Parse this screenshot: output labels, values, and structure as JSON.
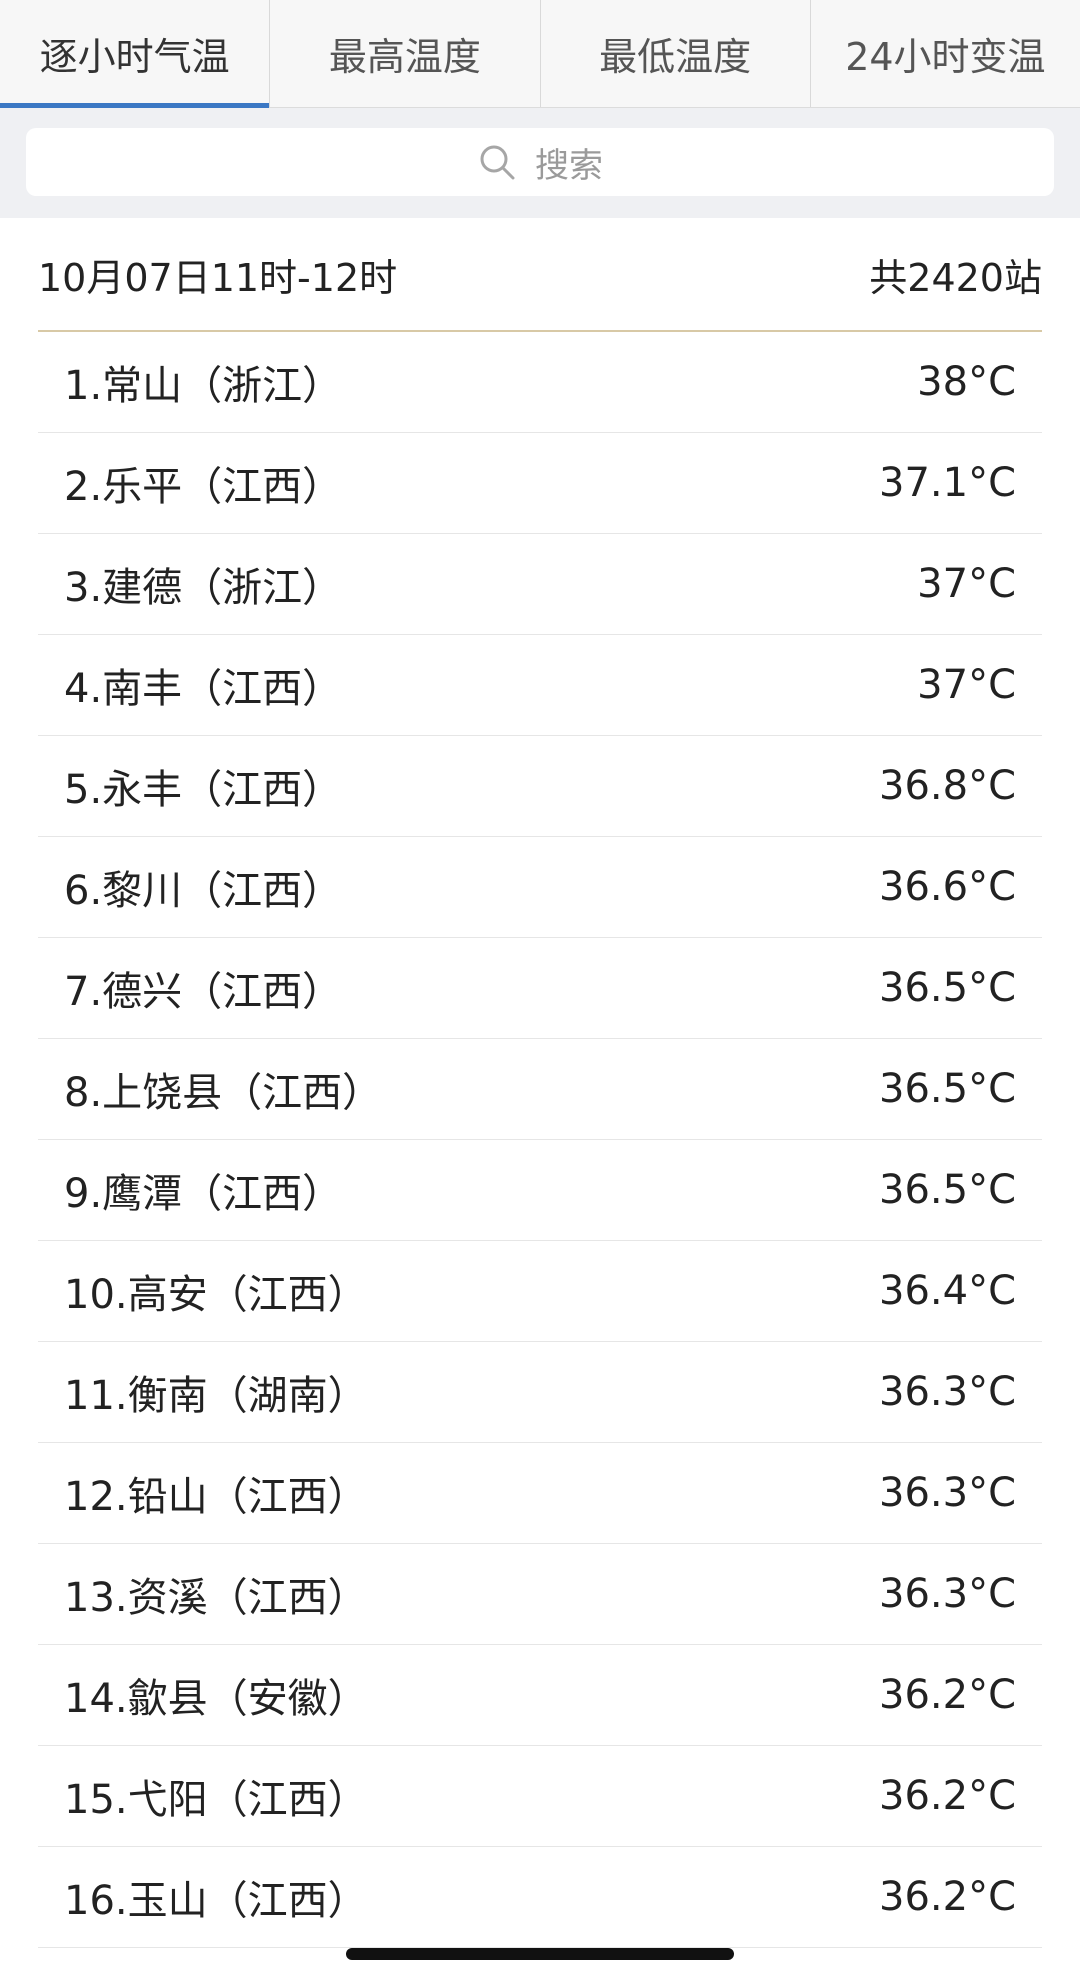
{
  "tabs": [
    {
      "label": "逐小时气温",
      "active": true
    },
    {
      "label": "最高温度",
      "active": false
    },
    {
      "label": "最低温度",
      "active": false
    },
    {
      "label": "24小时变温",
      "active": false
    }
  ],
  "search": {
    "placeholder": "搜索",
    "icon": "search-icon"
  },
  "summary": {
    "time_range": "10月07日11时-12时",
    "station_count": "共2420站"
  },
  "accent_color": "#3b78c4",
  "rows": [
    {
      "name": "1.常山（浙江）",
      "value": "38°C"
    },
    {
      "name": "2.乐平（江西）",
      "value": "37.1°C"
    },
    {
      "name": "3.建德（浙江）",
      "value": "37°C"
    },
    {
      "name": "4.南丰（江西）",
      "value": "37°C"
    },
    {
      "name": "5.永丰（江西）",
      "value": "36.8°C"
    },
    {
      "name": "6.黎川（江西）",
      "value": "36.6°C"
    },
    {
      "name": "7.德兴（江西）",
      "value": "36.5°C"
    },
    {
      "name": "8.上饶县（江西）",
      "value": "36.5°C"
    },
    {
      "name": "9.鹰潭（江西）",
      "value": "36.5°C"
    },
    {
      "name": "10.高安（江西）",
      "value": "36.4°C"
    },
    {
      "name": "11.衡南（湖南）",
      "value": "36.3°C"
    },
    {
      "name": "12.铅山（江西）",
      "value": "36.3°C"
    },
    {
      "name": "13.资溪（江西）",
      "value": "36.3°C"
    },
    {
      "name": "14.歙县（安徽）",
      "value": "36.2°C"
    },
    {
      "name": "15.弋阳（江西）",
      "value": "36.2°C"
    },
    {
      "name": "16.玉山（江西）",
      "value": "36.2°C"
    }
  ]
}
